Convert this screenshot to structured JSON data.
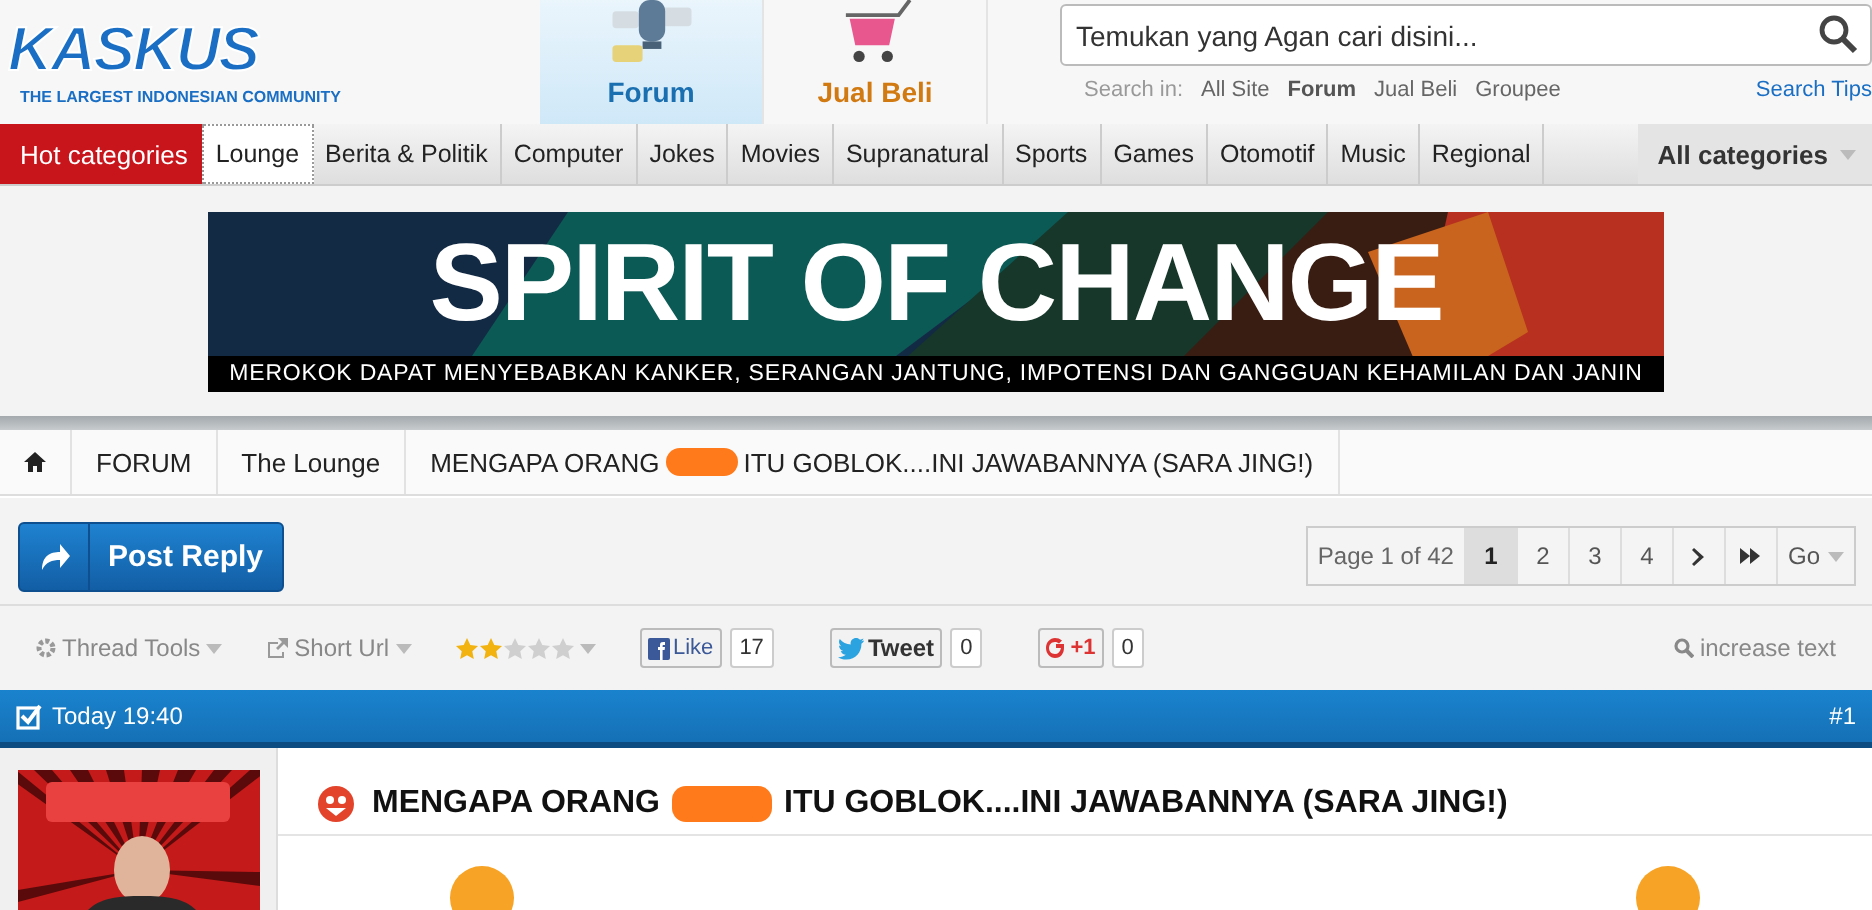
{
  "logo": {
    "name": "KASKUS",
    "tagline": "THE LARGEST INDONESIAN COMMUNITY"
  },
  "nav_tabs": [
    {
      "label": "Forum",
      "kind": "forum",
      "selected": true
    },
    {
      "label": "Jual Beli",
      "kind": "cart",
      "selected": false
    }
  ],
  "search": {
    "placeholder": "Temukan yang Agan cari disini...",
    "scope_label": "Search in:",
    "scopes": [
      {
        "label": "All Site",
        "selected": false
      },
      {
        "label": "Forum",
        "selected": true
      },
      {
        "label": "Jual Beli",
        "selected": false
      },
      {
        "label": "Groupee",
        "selected": false
      }
    ],
    "tips": "Search Tips"
  },
  "categories": {
    "hot_label": "Hot categories",
    "items": [
      {
        "label": "Lounge",
        "selected": true
      },
      {
        "label": "Berita & Politik",
        "selected": false
      },
      {
        "label": "Computer",
        "selected": false
      },
      {
        "label": "Jokes",
        "selected": false
      },
      {
        "label": "Movies",
        "selected": false
      },
      {
        "label": "Supranatural",
        "selected": false
      },
      {
        "label": "Sports",
        "selected": false
      },
      {
        "label": "Games",
        "selected": false
      },
      {
        "label": "Otomotif",
        "selected": false
      },
      {
        "label": "Music",
        "selected": false
      },
      {
        "label": "Regional",
        "selected": false
      }
    ],
    "all": "All categories"
  },
  "banner": {
    "headline": "SPIRIT OF CHANGE",
    "warning": "MEROKOK DAPAT MENYEBABKAN KANKER, SERANGAN JANTUNG, IMPOTENSI DAN GANGGUAN KEHAMILAN DAN JANIN"
  },
  "breadcrumb": [
    {
      "label": "FORUM"
    },
    {
      "label": "The Lounge"
    },
    {
      "label": "MENGAPA ORANG",
      "after_redaction": "ITU GOBLOK....INI JAWABANNYA (SARA JING!)"
    }
  ],
  "post_reply": "Post Reply",
  "pagination": {
    "summary": "Page 1 of 42",
    "pages": [
      {
        "label": "1",
        "selected": true
      },
      {
        "label": "2",
        "selected": false
      },
      {
        "label": "3",
        "selected": false
      },
      {
        "label": "4",
        "selected": false
      }
    ],
    "go": "Go"
  },
  "tools": {
    "thread_tools": "Thread Tools",
    "short_url": "Short Url",
    "stars": 2,
    "like": "Like",
    "like_count": "17",
    "tweet": "Tweet",
    "tweet_count": "0",
    "plus": "+1",
    "plus_count": "0",
    "increase_text": "increase text"
  },
  "post": {
    "time": "Today 19:40",
    "number": "#1",
    "title_before": "MENGAPA ORANG",
    "title_after": "ITU GOBLOK....INI JAWABANNYA (SARA JING!)"
  }
}
